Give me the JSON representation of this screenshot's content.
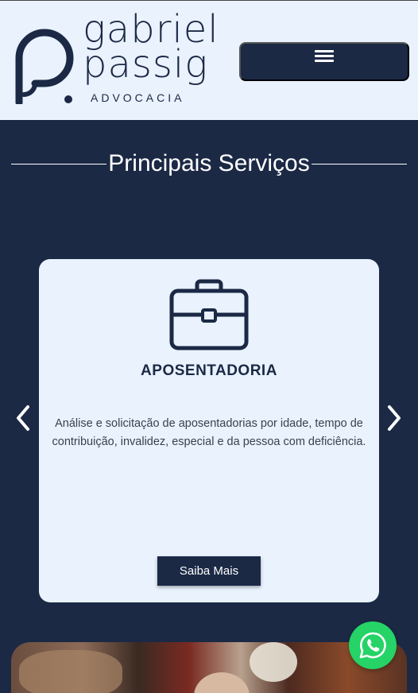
{
  "header": {
    "logo": {
      "line1": "gabriel",
      "line2": "passig",
      "subtitle": "ADVOCACIA"
    },
    "menu_icon": "hamburger-icon"
  },
  "services": {
    "title": "Principais Serviços",
    "card": {
      "icon": "briefcase-icon",
      "title": "APOSENTADORIA",
      "description": "Análise e solicitação de aposentadorias por idade, tempo de contribuição, invalidez, especial e da pessoa com deficiência.",
      "button_label": "Saiba Mais"
    },
    "prev_icon": "chevron-left-icon",
    "next_icon": "chevron-right-icon"
  },
  "floating": {
    "whatsapp_icon": "whatsapp-icon"
  },
  "colors": {
    "navy": "#1b2945",
    "light": "#e9f2fd",
    "whatsapp_green": "#25d366"
  }
}
